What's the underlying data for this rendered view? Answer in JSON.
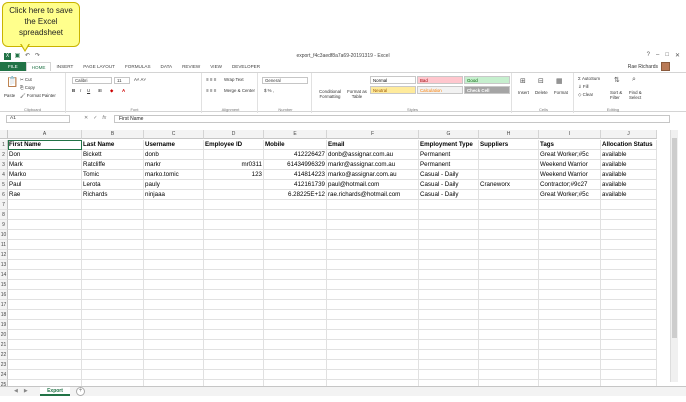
{
  "callout": {
    "text": "Click here to save the Excel spreadsheet"
  },
  "window": {
    "title": "export_f4c3aedf8a7a69-20191319 - Excel",
    "help": "?",
    "min": "–",
    "max": "□",
    "close": "✕"
  },
  "tabs": [
    {
      "label": "FILE"
    },
    {
      "label": "HOME"
    },
    {
      "label": "INSERT"
    },
    {
      "label": "PAGE LAYOUT"
    },
    {
      "label": "FORMULAS"
    },
    {
      "label": "DATA"
    },
    {
      "label": "REVIEW"
    },
    {
      "label": "VIEW"
    },
    {
      "label": "DEVELOPER"
    }
  ],
  "user": {
    "name": "Rae Richards"
  },
  "ribbon": {
    "clipboard": {
      "paste": "Paste",
      "cut": "Cut",
      "copy": "Copy",
      "format_painter": "Format Painter",
      "label": "Clipboard"
    },
    "font": {
      "name": "Calibri",
      "size": "11",
      "label": "Font"
    },
    "alignment": {
      "wrap": "Wrap Text",
      "merge": "Merge & Center",
      "label": "Alignment"
    },
    "number": {
      "format": "General",
      "label": "Number"
    },
    "styles": {
      "conditional": "Conditional Formatting",
      "format_as_table": "Format as Table",
      "normal": "Normal",
      "bad": "Bad",
      "good": "Good",
      "neutral": "Neutral",
      "calculation": "Calculation",
      "check_cell": "Check Cell",
      "label": "Styles"
    },
    "cells": {
      "insert": "Insert",
      "delete": "Delete",
      "format": "Format",
      "label": "Cells"
    },
    "editing": {
      "autosum": "AutoSum",
      "fill": "Fill",
      "clear": "Clear",
      "sort": "Sort & Filter",
      "find": "Find & Select",
      "label": "Editing"
    }
  },
  "formula_bar": {
    "namebox": "A1",
    "content": "First Name",
    "cancel": "✕",
    "enter": "✓",
    "fx": "fx"
  },
  "columns": [
    "A",
    "B",
    "C",
    "D",
    "E",
    "F",
    "G",
    "H",
    "I",
    "J"
  ],
  "rows": [
    [
      "First Name",
      "Last Name",
      "Username",
      "Employee ID",
      "Mobile",
      "Email",
      "Employment Type",
      "Suppliers",
      "Tags",
      "Allocation Status"
    ],
    [
      "Don",
      "Bickett",
      "donb",
      "",
      "412226427",
      "donb@assignar.com.au",
      "Permanent",
      "",
      "Great Worker;#5c",
      "available"
    ],
    [
      "Mark",
      "Ratcliffe",
      "markr",
      "mr0311",
      "61434996329",
      "markr@assignar.com.au",
      "Permanent",
      "",
      "Weekend Warrior",
      "available"
    ],
    [
      "Marko",
      "Tomic",
      "marko.tomic",
      "123",
      "414814223",
      "marko@assignar.com.au",
      "Casual - Daily",
      "",
      "Weekend Warrior",
      "available"
    ],
    [
      "Paul",
      "Lerota",
      "pauly",
      "",
      "412161739",
      "paul@hotmail.com",
      "Casual - Daily",
      "Craneworx",
      "Contractor;#9c27",
      "available"
    ],
    [
      "Rae",
      "Richards",
      "ninjaaa",
      "",
      "6.28225E+12",
      "rae.richards@hotmail.com",
      "Casual - Daily",
      "",
      "Great Worker;#5c",
      "available"
    ]
  ],
  "row_numbers": [
    "1",
    "2",
    "3",
    "4",
    "5",
    "6",
    "7",
    "8",
    "9",
    "10",
    "11",
    "12",
    "13",
    "14",
    "15",
    "16",
    "17",
    "18",
    "19",
    "20",
    "21",
    "22",
    "23",
    "24",
    "25"
  ],
  "sheet": {
    "name": "Export",
    "add": "+"
  }
}
